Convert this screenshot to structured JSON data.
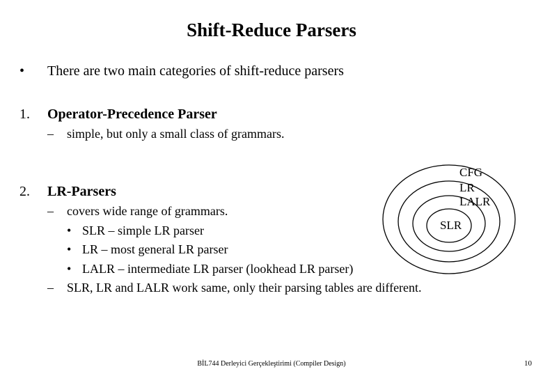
{
  "title": "Shift-Reduce Parsers",
  "line_intro": "There are two main categories of shift-reduce parsers",
  "section1": {
    "num": "1.",
    "heading": "Operator-Precedence Parser",
    "sub": "simple, but only a small class of grammars."
  },
  "section2": {
    "num": "2.",
    "heading": "LR-Parsers",
    "sub1": "covers wide range of grammars.",
    "pt1": "SLR – simple LR parser",
    "pt2": "LR – most general LR parser",
    "pt3": "LALR – intermediate LR parser (lookhead LR parser)",
    "sub2": "SLR, LR and LALR work same, only their parsing tables are different."
  },
  "diagram": {
    "l1": "CFG",
    "l2": "LR",
    "l3": "LALR",
    "l4": "SLR"
  },
  "footer_center": "BİL744 Derleyici Gerçekleştirimi (Compiler Design)",
  "footer_right": "10",
  "glyphs": {
    "bullet": "•",
    "dash": "–"
  }
}
